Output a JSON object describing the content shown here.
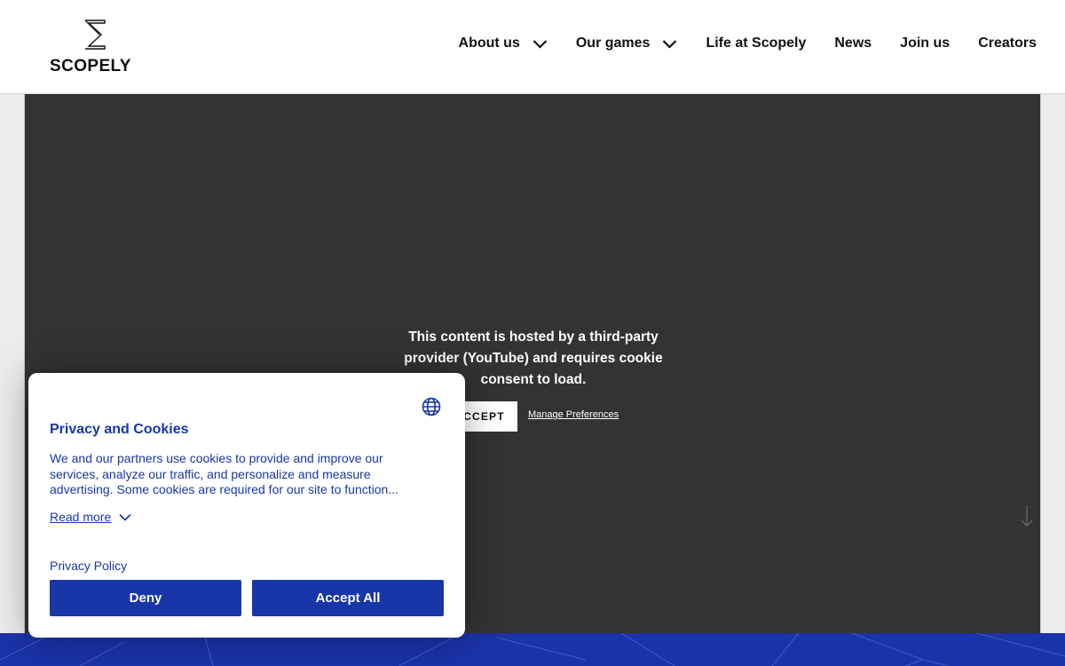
{
  "header": {
    "logo_text": "SCOPELY",
    "nav": [
      {
        "label": "About us",
        "has_dropdown": true
      },
      {
        "label": "Our games",
        "has_dropdown": true
      },
      {
        "label": "Life at Scopely",
        "has_dropdown": false
      },
      {
        "label": "News",
        "has_dropdown": false
      },
      {
        "label": "Join us",
        "has_dropdown": false
      },
      {
        "label": "Creators",
        "has_dropdown": false
      }
    ]
  },
  "video": {
    "message": "This content is hosted by a third-party provider (YouTube) and requires cookie consent to load.",
    "accept_label": "ACCEPT",
    "manage_label": "Manage Preferences"
  },
  "cookie_banner": {
    "title": "Privacy and Cookies",
    "description": "We and our partners use cookies to provide and improve our services, analyze our traffic, and personalize and measure advertising. Some cookies are required for our site to function...",
    "read_more": "Read more",
    "privacy_policy": "Privacy Policy",
    "deny": "Deny",
    "accept_all": "Accept All",
    "language_icon": "globe-icon"
  },
  "colors": {
    "brand_blue": "#1936a9",
    "video_bg": "#333333",
    "band_blue": "#1a33a8"
  }
}
